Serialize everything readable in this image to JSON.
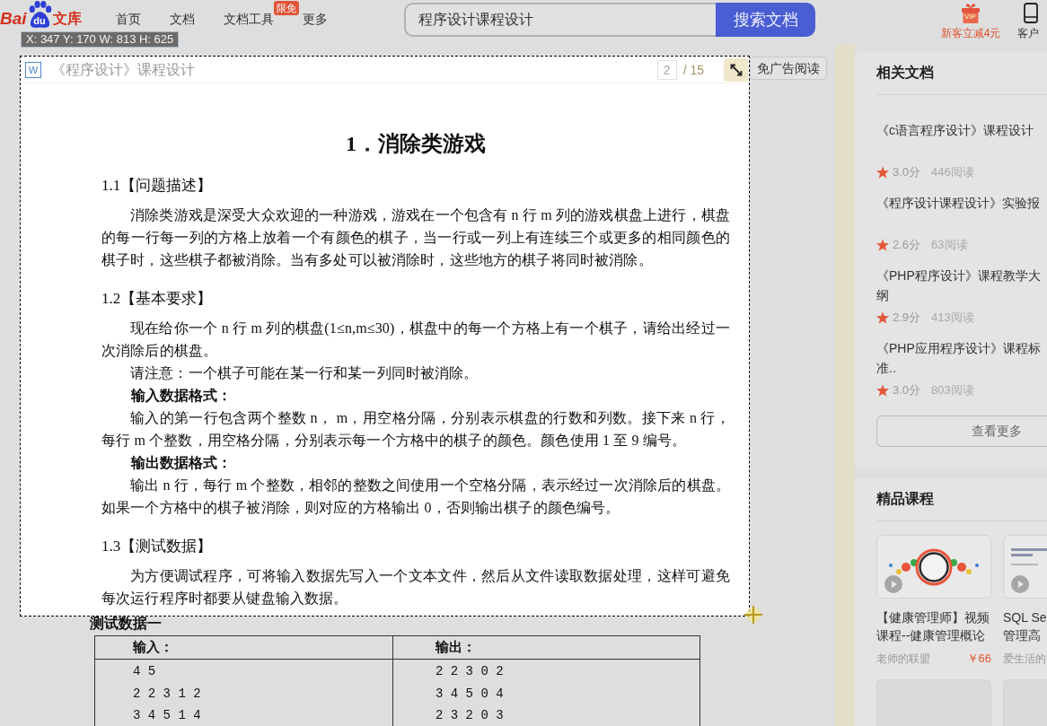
{
  "capture": {
    "readout": "X: 347 Y: 170 W: 813 H: 625"
  },
  "header": {
    "logo": {
      "left": "Bai",
      "paw": "du",
      "right": "文库"
    },
    "nav": [
      {
        "label": "首页"
      },
      {
        "label": "文档"
      },
      {
        "label": "文档工具",
        "badge": "限免"
      },
      {
        "label": "更多"
      }
    ],
    "search": {
      "value": "程序设计课程设计",
      "button": "搜索文档"
    },
    "vip": {
      "icon_text": "VIP",
      "label": "新客立减4元"
    },
    "client": {
      "label": "客户"
    }
  },
  "document": {
    "toolbar": {
      "file_badge": "W",
      "title": "《程序设计》课程设计",
      "page": "2",
      "total": "/ 15",
      "ad_free_button": "免广告阅读"
    },
    "heading": "1．消除类游戏",
    "blocks": [
      {
        "kind": "section",
        "text": "1.1【问题描述】"
      },
      {
        "kind": "paragraph",
        "text": "消除类游戏是深受大众欢迎的一种游戏，游戏在一个包含有 n 行 m 列的游戏棋盘上进行，棋盘的每一行每一列的方格上放着一个有颜色的棋子，当一行或一列上有连续三个或更多的相同颜色的棋子时，这些棋子都被消除。当有多处可以被消除时，这些地方的棋子将同时被消除。"
      },
      {
        "kind": "section",
        "text": "1.2【基本要求】"
      },
      {
        "kind": "paragraph",
        "text": "现在给你一个 n 行 m 列的棋盘(1≤n,m≤30)，棋盘中的每一个方格上有一个棋子，请给出经过一次消除后的棋盘。"
      },
      {
        "kind": "paragraph",
        "text": "请注意：一个棋子可能在某一行和某一列同时被消除。"
      },
      {
        "kind": "label",
        "text": "输入数据格式："
      },
      {
        "kind": "paragraph",
        "text": "输入的第一行包含两个整数 n， m，用空格分隔，分别表示棋盘的行数和列数。接下来 n 行，每行 m 个整数，用空格分隔，分别表示每一个方格中的棋子的颜色。颜色使用 1 至 9 编号。"
      },
      {
        "kind": "label",
        "text": "输出数据格式："
      },
      {
        "kind": "paragraph",
        "text": "输出 n 行，每行 m 个整数，相邻的整数之间使用一个空格分隔，表示经过一次消除后的棋盘。如果一个方格中的棋子被消除，则对应的方格输出 0，否则输出棋子的颜色编号。"
      },
      {
        "kind": "section",
        "text": "1.3【测试数据】"
      },
      {
        "kind": "paragraph",
        "text": "为方便调试程序，可将输入数据先写入一个文本文件，然后从文件读取数据处理，这样可避免每次运行程序时都要从键盘输入数据。"
      }
    ],
    "test_title": "测试数据一",
    "table": {
      "columns": [
        "输入：",
        "输出："
      ],
      "rows": [
        [
          "4 5",
          "2 2 3 0 2"
        ],
        [
          "2 2 3 1 2",
          "3 4 5 0 4"
        ],
        [
          "3 4 5 1 4",
          "2 3 2 0 3"
        ]
      ]
    }
  },
  "related": {
    "title": "相关文档",
    "items": [
      {
        "title": "《c语言程序设计》课程设计",
        "score": "3.0分",
        "reads": "446阅读"
      },
      {
        "title": "《程序设计课程设计》实验报",
        "score": "2.6分",
        "reads": "63阅读"
      },
      {
        "title": "《PHP程序设计》课程教学大纲",
        "score": "2.9分",
        "reads": "413阅读"
      },
      {
        "title": "《PHP应用程序设计》课程标准..",
        "score": "3.0分",
        "reads": "803阅读"
      }
    ],
    "more_button": "查看更多"
  },
  "courses": {
    "title": "精品课程",
    "items": [
      {
        "title_lines": [
          "【健康管理师】视频",
          "课程--健康管理概论"
        ],
        "author": "老师的联盟",
        "price": "￥66"
      },
      {
        "title_lines": [
          "SQL Se",
          "管理高"
        ],
        "author": "爱生活的"
      }
    ]
  }
}
